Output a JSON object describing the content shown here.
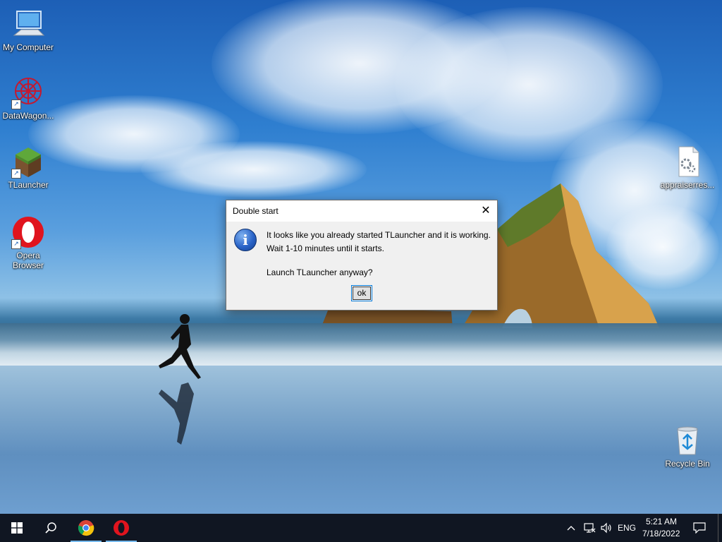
{
  "desktop": {
    "icons": [
      {
        "label": "My Computer"
      },
      {
        "label": "DataWagon..."
      },
      {
        "label": "TLauncher"
      },
      {
        "label": "Opera Browser"
      },
      {
        "label": "appraiserres..."
      },
      {
        "label": "Recycle Bin"
      }
    ]
  },
  "dialog": {
    "title": "Double start",
    "close_glyph": "✕",
    "icon": "information-icon",
    "line1": "It looks like you already started TLauncher and it is working.",
    "line2": "Wait 1-10 minutes until it starts.",
    "line3": "Launch TLauncher anyway?",
    "ok_label": "ok"
  },
  "taskbar": {
    "apps": [
      {
        "icon": "windows-start-icon"
      },
      {
        "icon": "search-icon"
      },
      {
        "icon": "chrome-icon"
      },
      {
        "icon": "opera-icon"
      }
    ],
    "tray": {
      "language": "ENG",
      "time": "5:21 AM",
      "date": "7/18/2022"
    }
  },
  "colors": {
    "taskbar": "#101622",
    "accent": "#0078d7",
    "opera_red": "#e0141e"
  }
}
